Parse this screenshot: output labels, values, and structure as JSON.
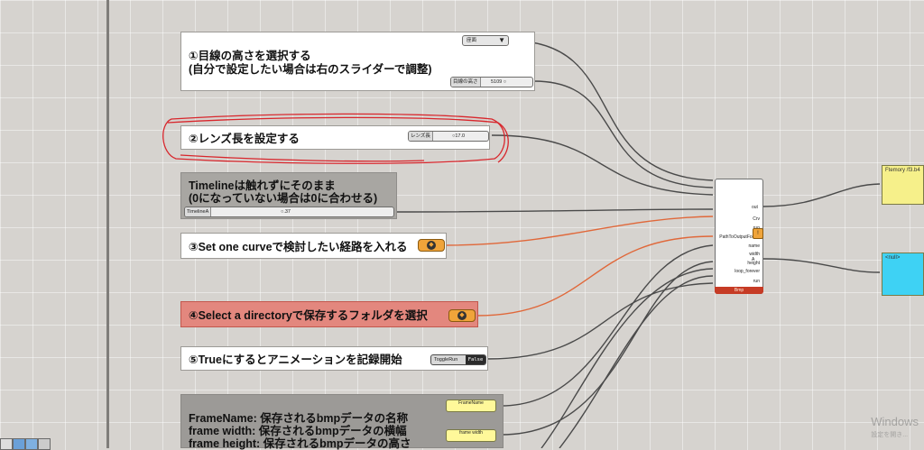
{
  "panels": {
    "eye_height": {
      "line1": "①目線の高さを選択する",
      "line2": "(自分で設定したい場合は右のスライダーで調整)",
      "dropdown_label": "座面",
      "slider_label": "目線の高さ",
      "slider_value": "5109 ○"
    },
    "lens": {
      "line1": "②レンズ長を設定する",
      "slider_label": "レンズ長",
      "slider_value": "○17.0"
    },
    "timeline": {
      "line1": "Timelineは触れずにそのまま",
      "line2": "(0になっていない場合は0に合わせる)",
      "slider_label": "TimelineA",
      "slider_value": "○.37"
    },
    "curve": {
      "line1": "③Set one curveで検討したい経路を入れる"
    },
    "directory": {
      "line1": "④Select a directoryで保存するフォルダを選択"
    },
    "record": {
      "line1": "⑤Trueにするとアニメーションを記録開始",
      "toggle_label": "ToggleRun",
      "toggle_value": "False"
    },
    "frame": {
      "line1": "FrameName: 保存されるbmpデータの名称",
      "line2": "frame width: 保存されるbmpデータの横幅",
      "line3": "frame height: 保存されるbmpデータの高さ",
      "param1_label": "FrameName",
      "param2_label": "frame width"
    }
  },
  "component": {
    "inputs": [
      "Crv",
      "run",
      "PathToOutputFolder",
      "name",
      "width",
      "height",
      "loop_forever",
      "run"
    ],
    "outputs": [
      "out",
      "A"
    ],
    "footer": "Bmp"
  },
  "outputs": {
    "yellow_panel_text": "Ftemory /f3.b4",
    "blue_panel_text": "<null>"
  },
  "watermark": {
    "line1": "Windows",
    "line2": "設定を開き..."
  },
  "colors": {
    "canvas": "#d6d3cf",
    "orange_wire": "#e0683a",
    "dark_wire": "#4a4a4a",
    "red_annotation": "#d8262c",
    "yellow_panel": "#f6f08a",
    "blue_panel": "#3ed2f4",
    "component_footer": "#c63b25"
  }
}
